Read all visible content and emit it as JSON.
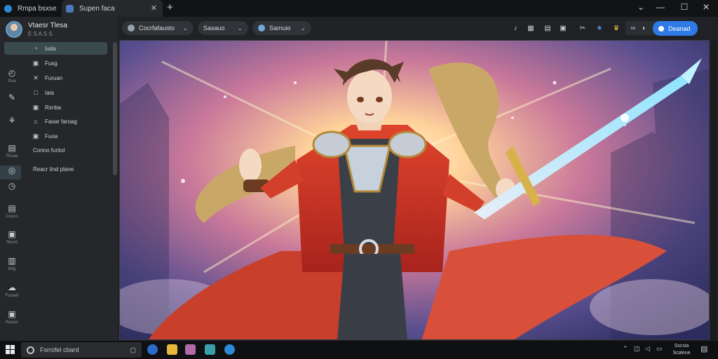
{
  "tabs": [
    {
      "label": "Rmpa bsxse"
    },
    {
      "label": "Supen faca"
    }
  ],
  "window": {
    "min": "⌄",
    "restore": "—",
    "max": "☐",
    "close": "✕"
  },
  "profile": {
    "name": "Vtaesr Tlesa",
    "sub": "E S A S S"
  },
  "menu": [
    {
      "icon": "◔",
      "label": "Iuda"
    },
    {
      "icon": "▣",
      "label": "Fusg"
    },
    {
      "icon": "✕",
      "label": "Furuan"
    },
    {
      "icon": "□",
      "label": "Iaia"
    },
    {
      "icon": "▣",
      "label": "Rsnba"
    },
    {
      "icon": "⌂",
      "label": "Faoar faroag"
    },
    {
      "icon": "▣",
      "label": "Fuoa"
    },
    {
      "icon": "",
      "label": "Conno furitol"
    },
    {
      "icon": "",
      "label": "Reacr tind plane"
    }
  ],
  "rail": [
    {
      "icon": "◴",
      "label": "Ihua"
    },
    {
      "icon": "✎",
      "label": ""
    },
    {
      "icon": "⚘",
      "label": ""
    },
    {
      "icon": "▤",
      "label": "Fhuaa"
    },
    {
      "icon": "◎",
      "label": ""
    },
    {
      "icon": "◷",
      "label": ""
    },
    {
      "icon": "▤",
      "label": "Cuuus"
    },
    {
      "icon": "▣",
      "label": "Resnt"
    },
    {
      "icon": "▥",
      "label": "Iblig"
    },
    {
      "icon": "☁",
      "label": "Fuoaef"
    },
    {
      "icon": "▣",
      "label": "Raoao"
    }
  ],
  "toolbar": {
    "dropdown1": "Cocrfafausto",
    "dropdown2": "Sasauo",
    "dropdown3": "Samuio",
    "primary": "Deanad"
  },
  "taskbar": {
    "search": "Fsrrofel cbard",
    "clock_time": "Sscsia",
    "clock_date": "Scaleue"
  },
  "colors": {
    "accent": "#2f7ae6",
    "sidebar": "#25272b",
    "active": "#3a4a4d"
  }
}
